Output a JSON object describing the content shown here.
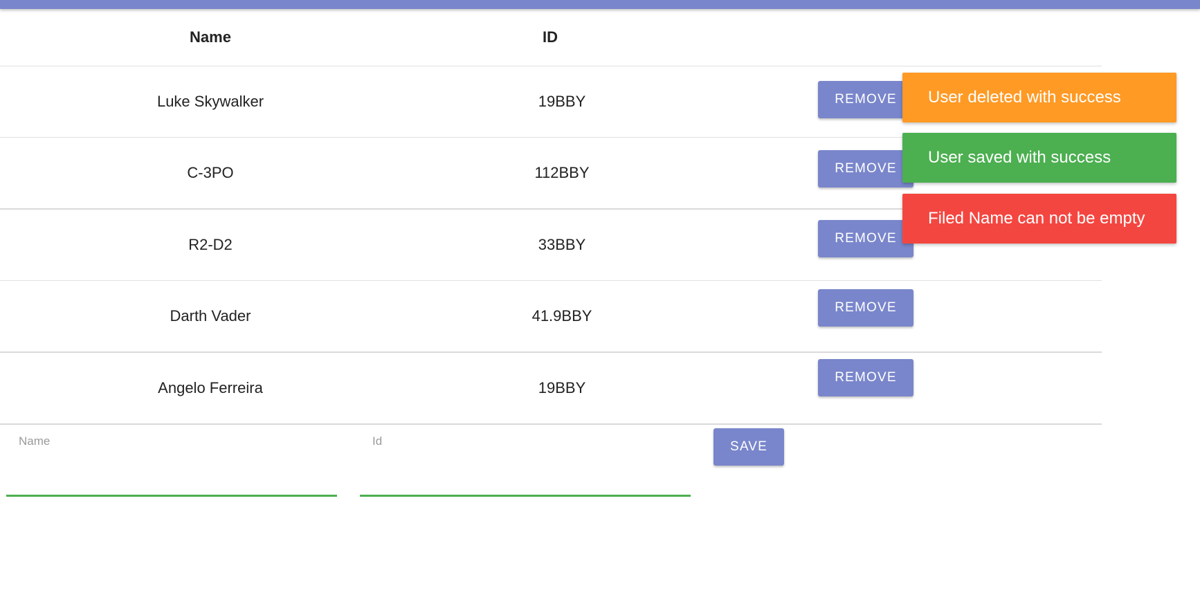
{
  "header": {
    "bar_color": "#7986cb"
  },
  "table": {
    "columns": {
      "name": "Name",
      "id": "ID"
    },
    "rows": [
      {
        "name": "Luke Skywalker",
        "id": "19BBY",
        "action": "REMOVE"
      },
      {
        "name": "C-3PO",
        "id": "112BBY",
        "action": "REMOVE"
      },
      {
        "name": "R2-D2",
        "id": "33BBY",
        "action": "REMOVE"
      },
      {
        "name": "Darth Vader",
        "id": "41.9BBY",
        "action": "REMOVE"
      },
      {
        "name": "Angelo Ferreira",
        "id": "19BBY",
        "action": "REMOVE"
      }
    ]
  },
  "form": {
    "name_label": "Name",
    "name_value": "",
    "id_label": "Id",
    "id_value": "",
    "save_label": "SAVE"
  },
  "toasts": [
    {
      "message": "User deleted with success",
      "color": "#ff9a25"
    },
    {
      "message": "User saved with success",
      "color": "#4caf50"
    },
    {
      "message": "Filed Name can not be empty",
      "color": "#f44640"
    }
  ]
}
